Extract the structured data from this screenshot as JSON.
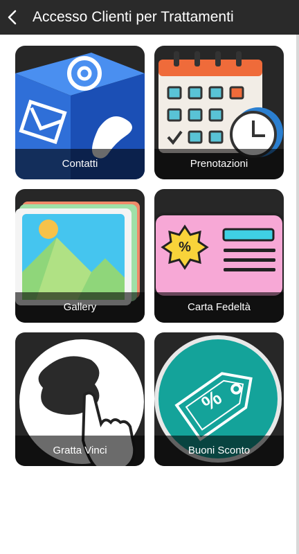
{
  "header": {
    "title": "Accesso Clienti per Trattamenti",
    "background": "#2a2a2a"
  },
  "tiles": [
    {
      "label": "Contatti",
      "icon": "contact-cube-icon"
    },
    {
      "label": "Prenotazioni",
      "icon": "calendar-clock-icon"
    },
    {
      "label": "Gallery",
      "icon": "photo-gallery-icon"
    },
    {
      "label": "Carta Fedeltà",
      "icon": "loyalty-card-icon"
    },
    {
      "label": "Gratta Vinci",
      "icon": "scratch-card-icon"
    },
    {
      "label": "Buoni Sconto",
      "icon": "discount-tag-icon"
    }
  ],
  "colors": {
    "tile_background": "#272727",
    "accent_teal": "#14a39a",
    "card_pink": "#f7a8d6"
  }
}
